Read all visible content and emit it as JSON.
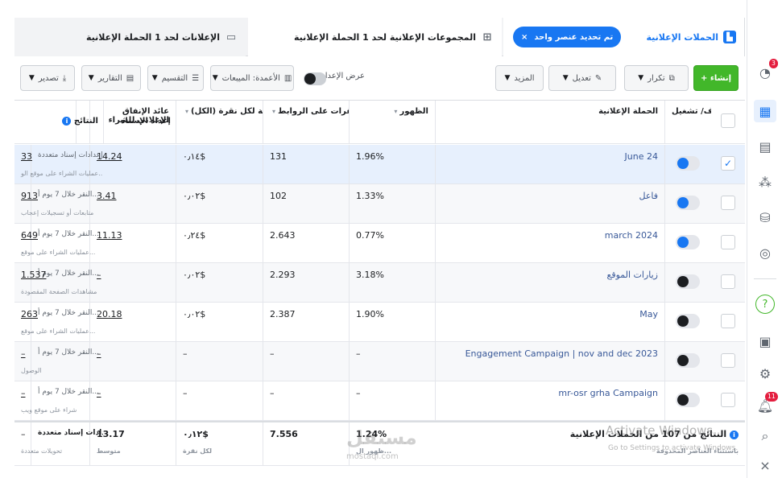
{
  "tabs": {
    "campaigns": "الحملات الإعلانية",
    "selected_pill": "تم تحديد عنصر واحد",
    "adsets": "المجموعات الإعلانية لحد 1 الحملة الإعلانية",
    "ads": "الإعلانات لحد 1 الحملة الإعلانية"
  },
  "toolbar": {
    "create": "+ إنشاء",
    "duplicate": "تكرار",
    "edit": "تعديل",
    "more": "المزيد",
    "view_setup": "عرض الإعداد",
    "columns": "الأعمدة: الميبعات",
    "breakdown": "التقسيم",
    "reports": "التقارير",
    "export": "تصدير"
  },
  "columns": {
    "onoff": "إيقاف/ تشغيل",
    "campaign": "الحملة الإعلانية",
    "appearance": "الظهور",
    "link_clicks": "النقرات على الروابط",
    "cost_per_click": "التكلفة لكل نقرة (الكل)",
    "roas": "عائد الإنفاق الإعلاني للشراء",
    "attribution": "إعداد الإسناد",
    "results": "النتائج"
  },
  "rows": [
    {
      "name": "June 24",
      "selected": true,
      "on": true,
      "appearance": "1.96%",
      "clicks": "131",
      "cpc": "٠٫١٤$",
      "roas": "14.24",
      "attribution": "إعدادات إسناد متعددة",
      "results": "33",
      "results_sub": "عمليات الشراء على موقع الو..."
    },
    {
      "name": "فاعل",
      "selected": false,
      "on": true,
      "appearance": "1.33%",
      "clicks": "102",
      "cpc": "٠٫٠٢$",
      "roas": "3.41",
      "attribution": "النقر خلال 7 يوم أ...",
      "results": "913",
      "results_sub": "متابعات أو تسجيلات إعجاب"
    },
    {
      "name": "march 2024",
      "selected": false,
      "on": true,
      "appearance": "0.77%",
      "clicks": "2.643",
      "cpc": "٠٫٢٤$",
      "roas": "11.13",
      "attribution": "النقر خلال 7 يوم أ...",
      "results": "649",
      "results_sub": "عمليات الشراء على موقع..."
    },
    {
      "name": "زيارات الموقع",
      "selected": false,
      "on": false,
      "appearance": "3.18%",
      "clicks": "2.293",
      "cpc": "٠٫٠٢$",
      "roas": "–",
      "attribution": "النقر خلال 7 يوم أ...",
      "results": "1.537",
      "results_sub": "مشاهدات الصفحة المقصودة"
    },
    {
      "name": "May",
      "selected": false,
      "on": false,
      "appearance": "1.90%",
      "clicks": "2.387",
      "cpc": "٠٫٠٢$",
      "roas": "20.18",
      "attribution": "النقر خلال 7 يوم أ...",
      "results": "263",
      "results_sub": "عمليات الشراء على موقع..."
    },
    {
      "name": "Engagement Campaign | nov and dec 2023",
      "selected": false,
      "on": false,
      "appearance": "–",
      "clicks": "–",
      "cpc": "–",
      "roas": "–",
      "attribution": "النقر خلال 7 يوم أ...",
      "results": "–",
      "results_sub": "الوصول"
    },
    {
      "name": "mr-osr grha Campaign",
      "selected": false,
      "on": false,
      "appearance": "–",
      "clicks": "–",
      "cpc": "–",
      "roas": "–",
      "attribution": "النقر خلال 7 يوم أ...",
      "results": "–",
      "results_sub": "شراء على موقع ويب"
    }
  ],
  "footer": {
    "label": "النتائج من 107 من الحملات الإعلانية",
    "label_sub": "باستثناء العناصر المحذوفة",
    "appearance": "1.24%",
    "appearance_sub": "ظهور ال...",
    "clicks": "7.556",
    "cpc": "٠٫١٢$",
    "cpc_sub": "لكل نقرة",
    "roas": "13.17",
    "roas_sub": "متوسط",
    "attribution": "إعدادات إسناد متعددة",
    "results": "–",
    "results_sub": "تحويلات متعددة"
  },
  "overlay": {
    "activate_title": "Activate Windows",
    "activate_sub": "Go to Settings to activate Windows.",
    "brand": "مستقل",
    "brand_url": "mostaql.com"
  },
  "rail": {
    "notif_badge": "3",
    "alerts_badge": "11",
    "help": "?"
  }
}
